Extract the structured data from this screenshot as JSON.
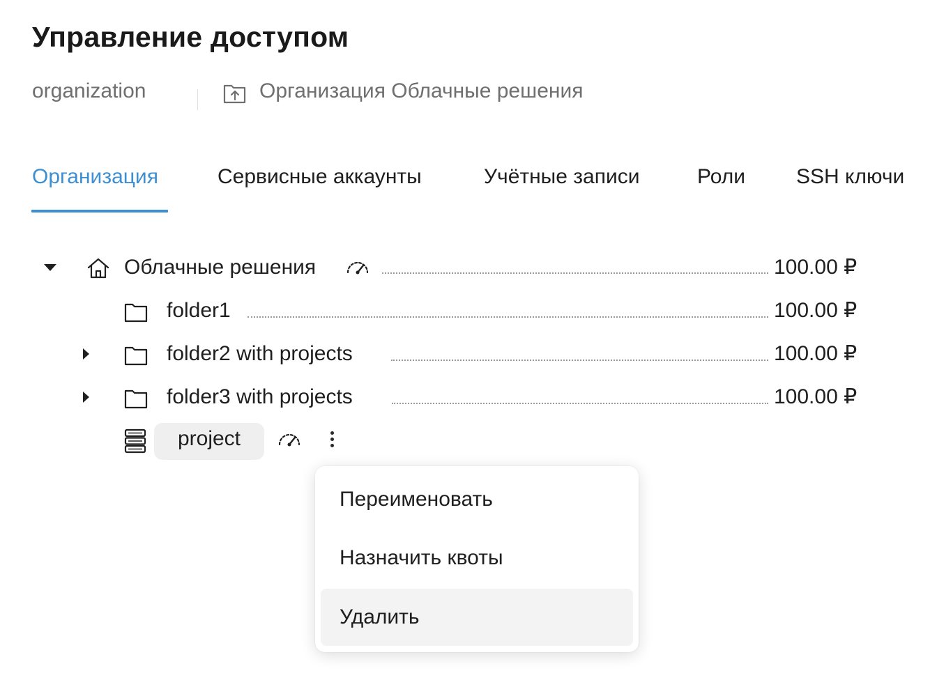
{
  "header": {
    "title": "Управление доступом"
  },
  "breadcrumb": {
    "organization": "organization",
    "folder": "Организация Облачные решения"
  },
  "tabs": [
    {
      "label": "Организация",
      "active": true
    },
    {
      "label": "Сервисные аккаунты",
      "active": false
    },
    {
      "label": "Учётные записи",
      "active": false
    },
    {
      "label": "Роли",
      "active": false
    },
    {
      "label": "SSH ключи",
      "active": false
    }
  ],
  "tree": {
    "root": {
      "label": "Облачные решения",
      "amount": "100.00 ₽",
      "expanded": true
    },
    "items": [
      {
        "label": "folder1",
        "amount": "100.00 ₽",
        "expandable": false
      },
      {
        "label": "folder2 with projects",
        "amount": "100.00 ₽",
        "expandable": true
      },
      {
        "label": "folder3 with projects",
        "amount": "100.00 ₽",
        "expandable": true
      }
    ],
    "project": {
      "label": "project"
    }
  },
  "context_menu": {
    "items": [
      {
        "label": "Переименовать"
      },
      {
        "label": "Назначить квоты"
      },
      {
        "label": "Удалить",
        "highlighted": true
      }
    ]
  },
  "colors": {
    "accent": "#3d8fd1",
    "text": "#1f1f1f",
    "muted": "#6f6f6f",
    "chip": "#efefef",
    "hover": "#f3f3f3"
  },
  "icons": [
    "folder-upload-icon",
    "home-icon",
    "quota-gauge-icon",
    "folder-icon",
    "server-icon",
    "more-vertical-icon",
    "caret-down-icon",
    "caret-right-icon"
  ]
}
